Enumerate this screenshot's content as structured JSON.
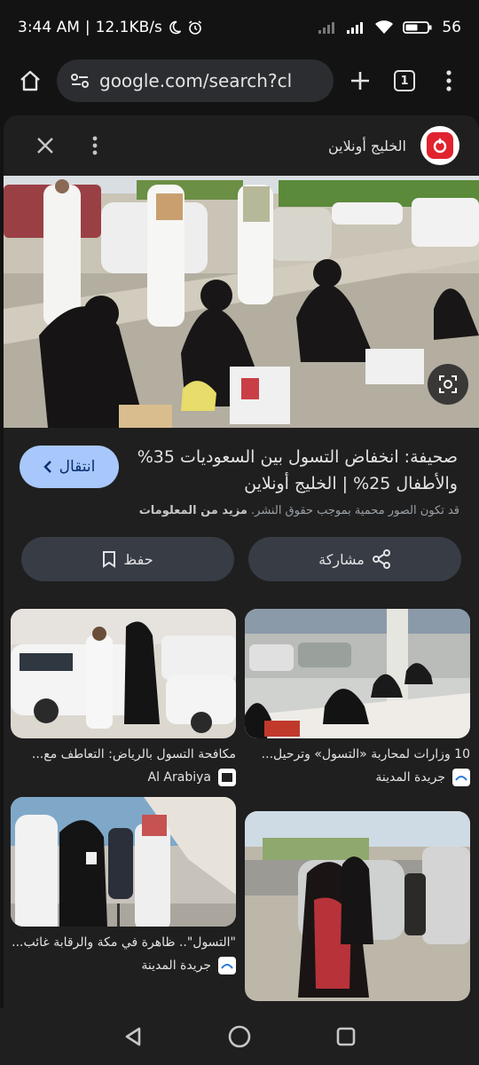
{
  "status": {
    "time": "3:44 AM",
    "net_speed": "12.1KB/s",
    "battery": "56"
  },
  "browser": {
    "url": "google.com/search?cl",
    "tab_count": "1"
  },
  "panel": {
    "source_name": "الخليج أونلاين",
    "result_title": "صحيفة: انخفاض التسول بين السعوديات 35% والأطفال 25% | الخليج أونلاين",
    "visit_label": "انتقال",
    "copyright_text": "قد تكون الصور محمية بموجب حقوق النشر.",
    "learn_more": "مزيد من المعلومات",
    "share_label": "مشاركة",
    "save_label": "حفظ"
  },
  "related": [
    {
      "title": "10 وزارات لمحاربة «التسول» وترحيل...",
      "source": "جريدة المدينة"
    },
    {
      "title": "مكافحة التسول بالرياض: التعاطف مع...",
      "source": "Al Arabiya"
    },
    {
      "title": "\"التسول\".. ظاهرة في مكة والرقابة غائب...",
      "source": "جريدة المدينة"
    },
    {
      "title": "",
      "source": ""
    }
  ],
  "colors": {
    "background": "#131314",
    "panel": "#1f1f1f",
    "accent": "#a8c7fa",
    "button": "#373c45"
  }
}
